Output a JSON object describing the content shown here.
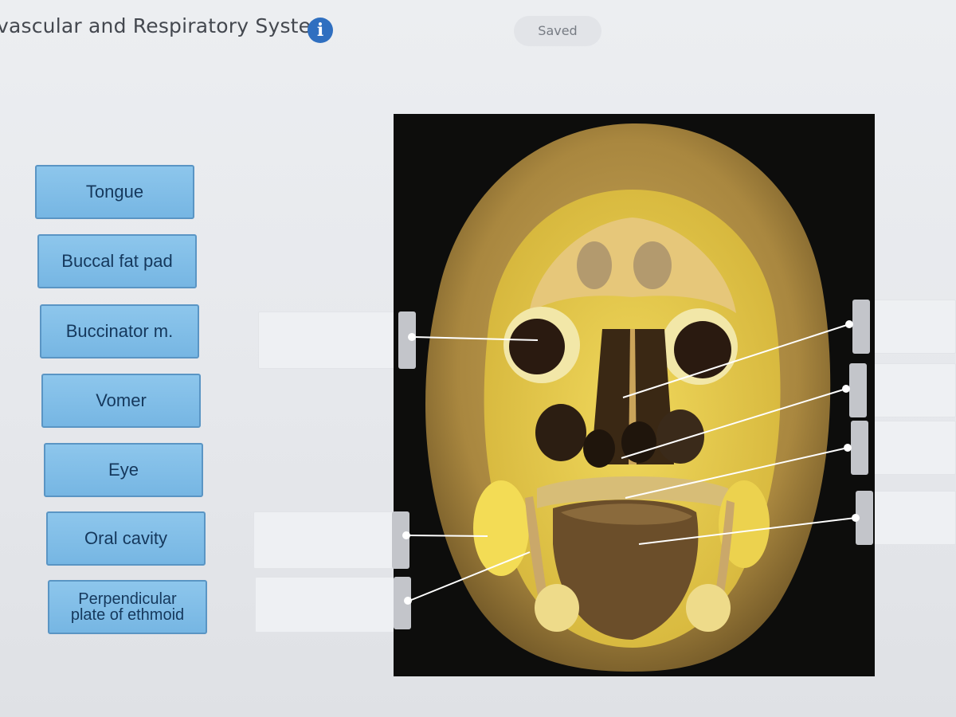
{
  "header": {
    "title": "vascular and Respiratory System",
    "info_icon": "info-icon",
    "save_status": "Saved"
  },
  "labels": [
    "Tongue",
    "Buccal fat pad",
    "Buccinator m.",
    "Vomer",
    "Eye",
    "Oral cavity",
    "Perpendicular plate of ethmoid"
  ],
  "drop_zones": [
    {
      "side": "left",
      "value": ""
    },
    {
      "side": "left",
      "value": ""
    },
    {
      "side": "left",
      "value": ""
    },
    {
      "side": "right",
      "value": ""
    },
    {
      "side": "right",
      "value": ""
    },
    {
      "side": "right",
      "value": ""
    },
    {
      "side": "right",
      "value": ""
    }
  ],
  "image": {
    "subject": "coronal-section-of-head-specimen"
  },
  "colors": {
    "label_fill": "#7fbde8",
    "label_border": "#5a95c4",
    "info_icon": "#2f6fc0"
  }
}
